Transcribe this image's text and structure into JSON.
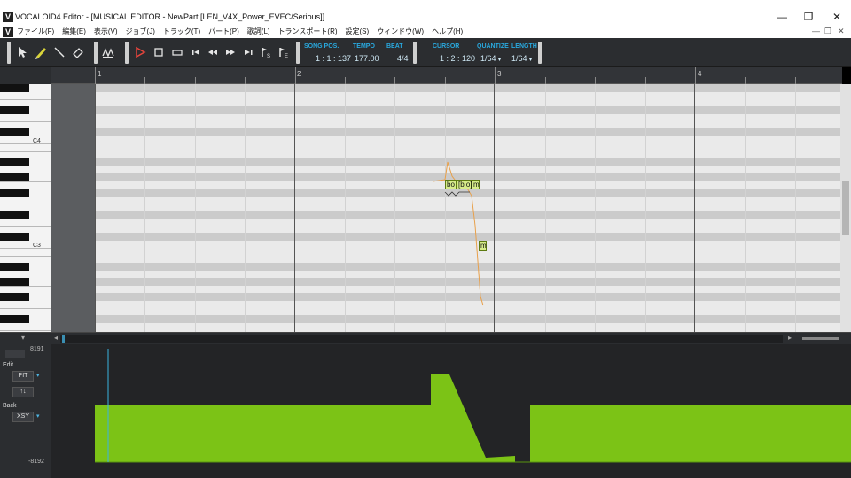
{
  "window": {
    "app_icon": "V",
    "title": "VOCALOID4 Editor - [MUSICAL EDITOR - NewPart [LEN_V4X_Power_EVEC/Serious]]",
    "minimize": "—",
    "restore": "❐",
    "close": "✕"
  },
  "menu": {
    "icon": "V",
    "items": [
      "ファイル(F)",
      "編集(E)",
      "表示(V)",
      "ジョブ(J)",
      "トラック(T)",
      "パート(P)",
      "歌詞(L)",
      "トランスポート(R)",
      "設定(S)",
      "ウィンドウ(W)",
      "ヘルプ(H)"
    ],
    "mdi_min": "—",
    "mdi_restore": "❐",
    "mdi_close": "✕"
  },
  "toolbar": {
    "icons": {
      "arrow": "arrow-tool-icon",
      "pencil": "pencil-tool-icon",
      "line": "line-tool-icon",
      "eraser": "eraser-tool-icon",
      "vibrato": "vibrato-icon",
      "play": "play-icon",
      "stop": "stop-icon",
      "loop": "loop-icon",
      "home": "rewind-to-start-icon",
      "rewind": "rewind-icon",
      "ff": "fast-forward-icon",
      "end": "forward-to-end-icon",
      "marker_s": "start-marker-icon",
      "marker_e": "end-marker-icon"
    },
    "song_pos_label": "SONG POS.",
    "song_pos": "1 : 1 : 137",
    "tempo_label": "TEMPO",
    "tempo": "177.00",
    "beat_label": "BEAT",
    "beat": "4/4",
    "cursor_label": "CURSOR",
    "cursor": "1 : 2 : 120",
    "quantize_label": "QUANTIZE",
    "quantize": "1/64",
    "length_label": "LENGTH",
    "length": "1/64"
  },
  "ruler": {
    "bars": [
      "1",
      "2",
      "3",
      "4"
    ]
  },
  "piano": {
    "octave_labels": [
      "C4",
      "C3"
    ]
  },
  "notes": [
    {
      "lyric": "bo"
    },
    {
      "lyric": "[b o]"
    },
    {
      "lyric": "m"
    },
    {
      "lyric": "m"
    }
  ],
  "control_track": {
    "max": "8191",
    "min": "-8192",
    "edit_label": "Edit",
    "edit_param": "PIT",
    "arrows": "↑↓",
    "back_label": "Back",
    "back_param": "XSY"
  },
  "colors": {
    "pitch_curve": "#e8a04a",
    "pit_fill": "#7cc316",
    "accent": "#29a9df"
  }
}
